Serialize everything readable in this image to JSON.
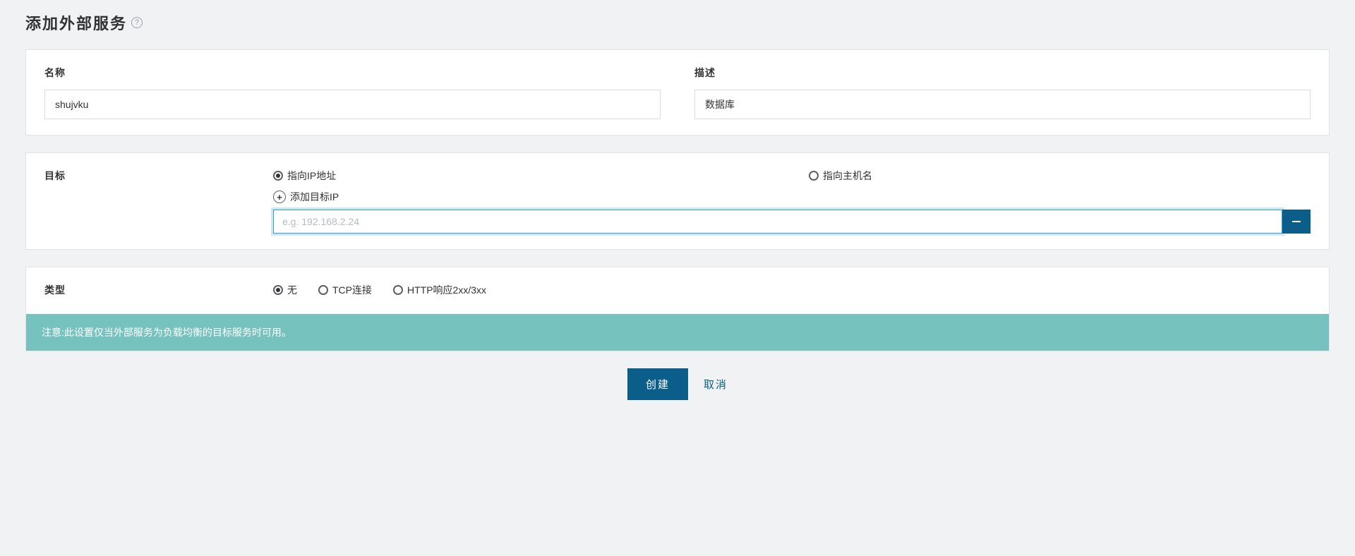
{
  "page": {
    "title": "添加外部服务",
    "help_icon_glyph": "?"
  },
  "panel_name": {
    "name_label": "名称",
    "name_value": "shujvku",
    "description_label": "描述",
    "description_value": "数据库"
  },
  "panel_target": {
    "section_label": "目标",
    "radio_ip_label": "指向IP地址",
    "radio_hostname_label": "指向主机名",
    "selected_mode": "ip",
    "add_ip_label": "添加目标IP",
    "plus_glyph": "+",
    "ip_entries": [
      {
        "value": "",
        "placeholder": "e.g. 192.168.2.24"
      }
    ]
  },
  "panel_type": {
    "section_label": "类型",
    "options": {
      "none": "无",
      "tcp": "TCP连接",
      "http": "HTTP响应2xx/3xx"
    },
    "selected": "none",
    "notice": "注意:此设置仅当外部服务为负载均衡的目标服务时可用。"
  },
  "footer": {
    "create_label": "创建",
    "cancel_label": "取消"
  },
  "colors": {
    "primary": "#0a5e89",
    "notice_bg": "#76c2bf",
    "page_bg": "#f1f2f4",
    "panel_bg": "#ffffff"
  }
}
